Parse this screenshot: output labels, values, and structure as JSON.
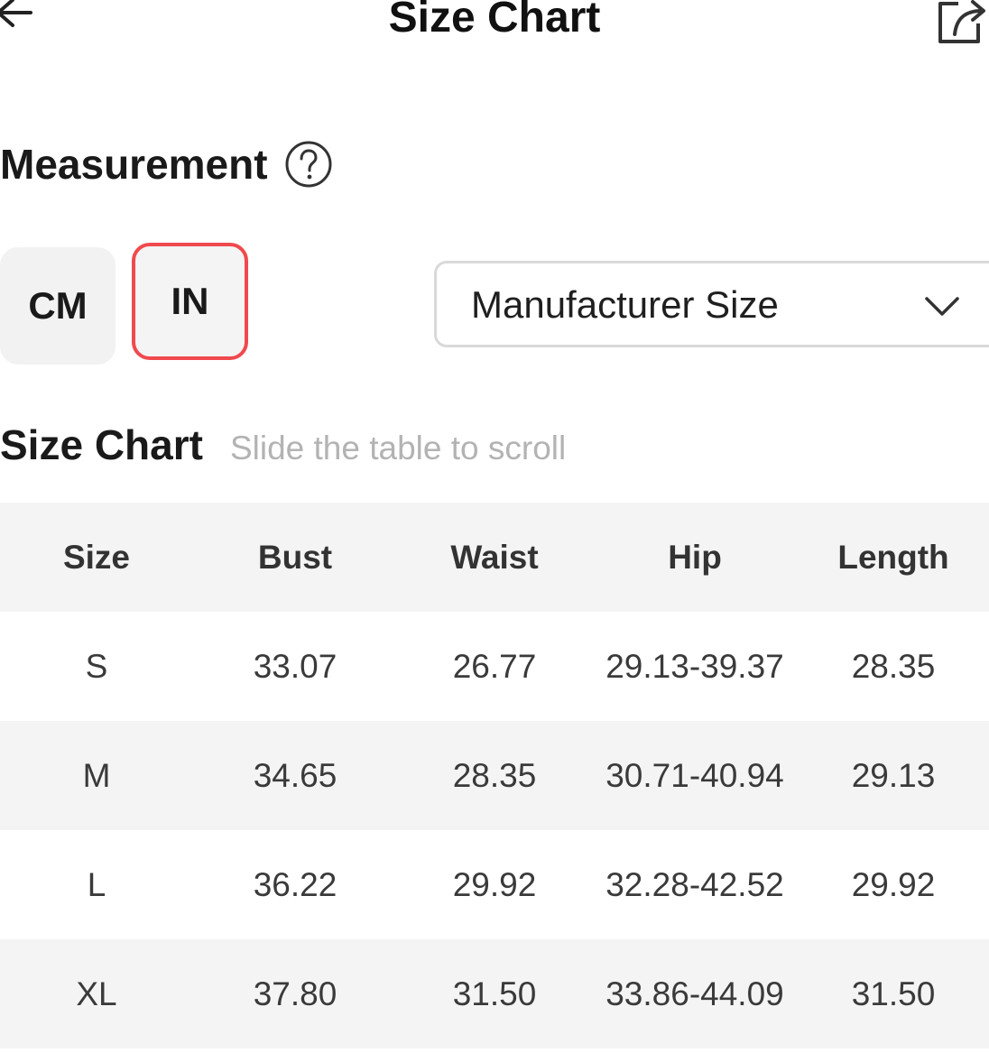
{
  "header": {
    "title": "Size Chart"
  },
  "measurement": {
    "title": "Measurement"
  },
  "units": {
    "cm_label": "CM",
    "in_label": "IN",
    "selected": "IN"
  },
  "size_select": {
    "value": "Manufacturer Size"
  },
  "chart": {
    "title": "Size Chart",
    "hint": "Slide the table to scroll"
  },
  "table": {
    "headers": [
      "Size",
      "Bust",
      "Waist",
      "Hip",
      "Length"
    ],
    "rows": [
      [
        "S",
        "33.07",
        "26.77",
        "29.13-39.37",
        "28.35"
      ],
      [
        "M",
        "34.65",
        "28.35",
        "30.71-40.94",
        "29.13"
      ],
      [
        "L",
        "36.22",
        "29.92",
        "32.28-42.52",
        "29.92"
      ],
      [
        "XL",
        "37.80",
        "31.50",
        "33.86-44.09",
        "31.50"
      ]
    ]
  },
  "colors": {
    "accent": "#f0494e",
    "row_shade": "#f4f4f4",
    "hint_text": "#b3b3b3"
  },
  "icons": {
    "back": "back-arrow-icon",
    "share": "share-icon",
    "help": "question-circle-icon",
    "dropdown": "chevron-down-icon"
  }
}
